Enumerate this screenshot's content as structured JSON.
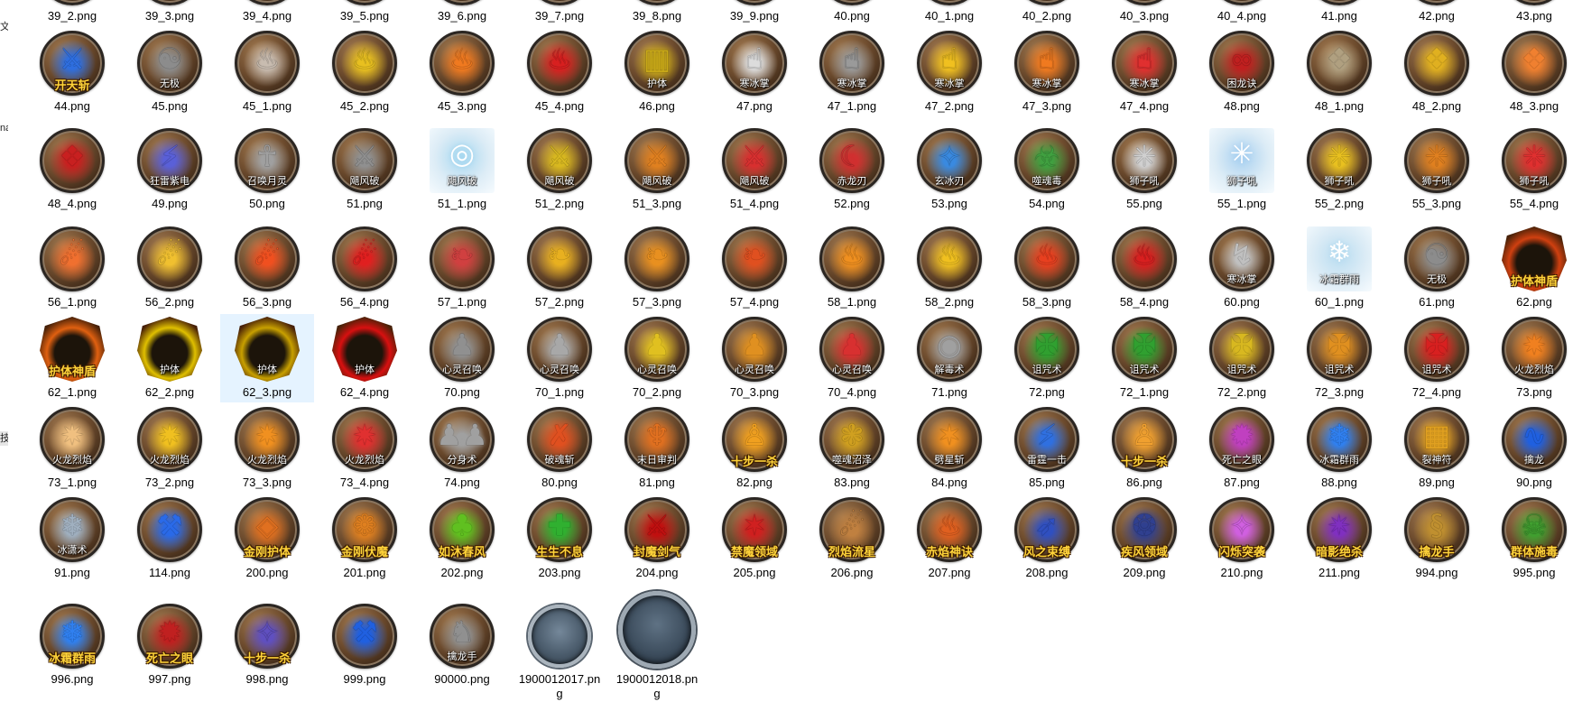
{
  "sidebar": {
    "fragments": [
      "文件",
      "na",
      "技"
    ]
  },
  "rows": [
    [
      {
        "file": "39_2.png",
        "icon": "skill-badge",
        "color": "#b86a2a"
      },
      {
        "file": "39_3.png",
        "icon": "skill-badge",
        "color": "#a0522d"
      },
      {
        "file": "39_4.png",
        "icon": "skill-badge",
        "color": "#c07a30"
      },
      {
        "file": "39_5.png",
        "icon": "skill-badge",
        "color": "#9a6a3a"
      },
      {
        "file": "39_6.png",
        "icon": "skill-badge",
        "color": "#c06030"
      },
      {
        "file": "39_7.png",
        "icon": "skill-badge",
        "color": "#b04a2a"
      },
      {
        "file": "39_8.png",
        "icon": "skill-badge",
        "color": "#c08a3a"
      },
      {
        "file": "39_9.png",
        "icon": "skill-badge",
        "color": "#a06040"
      },
      {
        "file": "40.png",
        "icon": "skill-badge",
        "color": "#8a6a4a"
      },
      {
        "file": "40_1.png",
        "icon": "skill-badge",
        "color": "#b07040"
      },
      {
        "file": "40_2.png",
        "icon": "skill-badge",
        "color": "#c09030"
      },
      {
        "file": "40_3.png",
        "icon": "skill-badge",
        "color": "#b06030"
      },
      {
        "file": "40_4.png",
        "icon": "skill-badge",
        "color": "#c04a2a"
      },
      {
        "file": "41.png",
        "icon": "skill-badge",
        "color": "#7a6a5a"
      },
      {
        "file": "42.png",
        "icon": "skill-badge",
        "color": "#c0a030"
      },
      {
        "file": "43.png",
        "icon": "skill-badge",
        "color": "#a06a40"
      }
    ],
    [
      {
        "file": "44.png",
        "icon": "blade-storm",
        "color": "#2f6fe0",
        "caption": "开天斩",
        "caption_style": "gold"
      },
      {
        "file": "45.png",
        "icon": "yin-yang",
        "color": "#8c8c8c",
        "caption": "无极"
      },
      {
        "file": "45_1.png",
        "icon": "flame-swirl",
        "color": "#c8bcb0"
      },
      {
        "file": "45_2.png",
        "icon": "flame-swirl",
        "color": "#e8c020"
      },
      {
        "file": "45_3.png",
        "icon": "flame-swirl",
        "color": "#f07a20"
      },
      {
        "file": "45_4.png",
        "icon": "flame-swirl",
        "color": "#d82020"
      },
      {
        "file": "46.png",
        "icon": "armor",
        "color": "#c8a818",
        "caption": "护体"
      },
      {
        "file": "47.png",
        "icon": "palm",
        "color": "#dcdcdc",
        "caption": "寒冰掌"
      },
      {
        "file": "47_1.png",
        "icon": "palm",
        "color": "#9a9a9a",
        "caption": "寒冰掌"
      },
      {
        "file": "47_2.png",
        "icon": "palm",
        "color": "#f0c020",
        "caption": "寒冰掌"
      },
      {
        "file": "47_3.png",
        "icon": "palm",
        "color": "#f07a20",
        "caption": "寒冰掌"
      },
      {
        "file": "47_4.png",
        "icon": "palm",
        "color": "#e03030",
        "caption": "寒冰掌"
      },
      {
        "file": "48.png",
        "icon": "dragon-knot",
        "color": "#c02020",
        "caption": "困龙诀"
      },
      {
        "file": "48_1.png",
        "icon": "totem",
        "color": "#b0a080"
      },
      {
        "file": "48_2.png",
        "icon": "totem",
        "color": "#e0b020"
      },
      {
        "file": "48_3.png",
        "icon": "totem",
        "color": "#f08030"
      }
    ],
    [
      {
        "file": "48_4.png",
        "icon": "totem",
        "color": "#c82020"
      },
      {
        "file": "49.png",
        "icon": "lightning",
        "color": "#5a60d8",
        "caption": "狂雷紫电"
      },
      {
        "file": "50.png",
        "icon": "summon",
        "color": "#a0a0a0",
        "caption": "召唤月灵"
      },
      {
        "file": "51.png",
        "icon": "sword",
        "color": "#909090",
        "caption": "飓风破"
      },
      {
        "file": "51_1.png",
        "icon": "whirlwind",
        "color": "#a8d8f0",
        "caption": "飓风破",
        "shape": "bare"
      },
      {
        "file": "51_2.png",
        "icon": "sword",
        "color": "#d8b820",
        "caption": "飓风破"
      },
      {
        "file": "51_3.png",
        "icon": "sword",
        "color": "#e08020",
        "caption": "飓风破"
      },
      {
        "file": "51_4.png",
        "icon": "sword",
        "color": "#d83030",
        "caption": "飓风破"
      },
      {
        "file": "52.png",
        "icon": "crescent-blade",
        "color": "#d03030",
        "caption": "赤龙刃"
      },
      {
        "file": "53.png",
        "icon": "ice-blade",
        "color": "#3a8ae0",
        "caption": "玄冰刃"
      },
      {
        "file": "54.png",
        "icon": "poison",
        "color": "#40a040",
        "caption": "噬魂毒"
      },
      {
        "file": "55.png",
        "icon": "roar",
        "color": "#d0d0d0",
        "caption": "狮子吼"
      },
      {
        "file": "55_1.png",
        "icon": "roar",
        "color": "#a8d0f0",
        "caption": "狮子吼",
        "shape": "bare"
      },
      {
        "file": "55_2.png",
        "icon": "roar",
        "color": "#e8c020",
        "caption": "狮子吼"
      },
      {
        "file": "55_3.png",
        "icon": "roar",
        "color": "#e08020",
        "caption": "狮子吼"
      },
      {
        "file": "55_4.png",
        "icon": "roar",
        "color": "#e03030",
        "caption": "狮子吼"
      }
    ],
    [
      {
        "file": "56_1.png",
        "icon": "fireball",
        "color": "#f07030"
      },
      {
        "file": "56_2.png",
        "icon": "fireball",
        "color": "#f0c030"
      },
      {
        "file": "56_3.png",
        "icon": "fireball",
        "color": "#f05020"
      },
      {
        "file": "56_4.png",
        "icon": "fireball",
        "color": "#e02020"
      },
      {
        "file": "57_1.png",
        "icon": "phoenix",
        "color": "#d04040"
      },
      {
        "file": "57_2.png",
        "icon": "phoenix",
        "color": "#e8b020"
      },
      {
        "file": "57_3.png",
        "icon": "phoenix",
        "color": "#e89020"
      },
      {
        "file": "57_4.png",
        "icon": "phoenix",
        "color": "#e05020"
      },
      {
        "file": "58_1.png",
        "icon": "flame-pillar",
        "color": "#f09020"
      },
      {
        "file": "58_2.png",
        "icon": "flame-pillar",
        "color": "#f0c020"
      },
      {
        "file": "58_3.png",
        "icon": "flame-pillar",
        "color": "#e84020"
      },
      {
        "file": "58_4.png",
        "icon": "flame-pillar",
        "color": "#d82020"
      },
      {
        "file": "60.png",
        "icon": "claw",
        "color": "#c0c0c0",
        "caption": "寒冰掌"
      },
      {
        "file": "60_1.png",
        "icon": "ice-shards",
        "color": "#b8dcf0",
        "caption": "冰霜群雨",
        "shape": "bare"
      },
      {
        "file": "61.png",
        "icon": "yin-yang",
        "color": "#8c8c8c",
        "caption": "无极"
      },
      {
        "file": "62.png",
        "icon": "shield",
        "color": "#d04010",
        "caption": "护体神盾",
        "caption_style": "gold",
        "shape": "shield"
      }
    ],
    [
      {
        "file": "62_1.png",
        "icon": "shield",
        "color": "#e06010",
        "caption": "护体神盾",
        "caption_style": "gold",
        "shape": "shield"
      },
      {
        "file": "62_2.png",
        "icon": "shield",
        "color": "#e0c000",
        "caption": "护体",
        "shape": "shield"
      },
      {
        "file": "62_3.png",
        "icon": "shield",
        "color": "#c8a000",
        "caption": "护体",
        "shape": "shield",
        "selected": true
      },
      {
        "file": "62_4.png",
        "icon": "shield",
        "color": "#d81010",
        "caption": "护体",
        "shape": "shield"
      },
      {
        "file": "70.png",
        "icon": "person",
        "color": "#909090",
        "caption": "心灵召唤"
      },
      {
        "file": "70_1.png",
        "icon": "person",
        "color": "#a8a8a8",
        "caption": "心灵召唤"
      },
      {
        "file": "70_2.png",
        "icon": "person",
        "color": "#e0c020",
        "caption": "心灵召唤"
      },
      {
        "file": "70_3.png",
        "icon": "person",
        "color": "#e09020",
        "caption": "心灵召唤"
      },
      {
        "file": "70_4.png",
        "icon": "person",
        "color": "#d83030",
        "caption": "心灵召唤"
      },
      {
        "file": "71.png",
        "icon": "eye",
        "color": "#a0a0a0",
        "caption": "解毒术"
      },
      {
        "file": "72.png",
        "icon": "curse-rune",
        "color": "#30a030",
        "caption": "诅咒术"
      },
      {
        "file": "72_1.png",
        "icon": "curse-rune",
        "color": "#30a030",
        "caption": "诅咒术"
      },
      {
        "file": "72_2.png",
        "icon": "curse-rune",
        "color": "#d8b820",
        "caption": "诅咒术"
      },
      {
        "file": "72_3.png",
        "icon": "curse-rune",
        "color": "#e09020",
        "caption": "诅咒术"
      },
      {
        "file": "72_4.png",
        "icon": "curse-rune",
        "color": "#d82020",
        "caption": "诅咒术"
      },
      {
        "file": "73.png",
        "icon": "fist-burst",
        "color": "#f08020",
        "caption": "火龙烈焰"
      }
    ],
    [
      {
        "file": "73_1.png",
        "icon": "fist-burst",
        "color": "#f0c080",
        "caption": "火龙烈焰"
      },
      {
        "file": "73_2.png",
        "icon": "fist-burst",
        "color": "#f0c020",
        "caption": "火龙烈焰"
      },
      {
        "file": "73_3.png",
        "icon": "fist-burst",
        "color": "#f09020",
        "caption": "火龙烈焰"
      },
      {
        "file": "73_4.png",
        "icon": "fist-burst",
        "color": "#e03030",
        "caption": "火龙烈焰"
      },
      {
        "file": "74.png",
        "icon": "twin-figures",
        "color": "#a0a0a0",
        "caption": "分身术"
      },
      {
        "file": "80.png",
        "icon": "slash",
        "color": "#e05020",
        "caption": "破魂斩"
      },
      {
        "file": "81.png",
        "icon": "dragon-head",
        "color": "#e07020",
        "caption": "末日审判"
      },
      {
        "file": "82.png",
        "icon": "warrior",
        "color": "#f0a020",
        "caption": "十步一杀",
        "caption_style": "gold"
      },
      {
        "file": "83.png",
        "icon": "swamp",
        "color": "#d0a020",
        "caption": "噬魂沼泽"
      },
      {
        "file": "84.png",
        "icon": "star-strike",
        "color": "#f09020",
        "caption": "劈星斩"
      },
      {
        "file": "85.png",
        "icon": "thunder-strike",
        "color": "#3070e0",
        "caption": "雷霆一击"
      },
      {
        "file": "86.png",
        "icon": "warrior",
        "color": "#f0a030",
        "caption": "十步一杀",
        "caption_style": "gold"
      },
      {
        "file": "87.png",
        "icon": "death-eye",
        "color": "#c040c0",
        "caption": "死亡之眼"
      },
      {
        "file": "88.png",
        "icon": "ice-rain",
        "color": "#3080f0",
        "caption": "冰霜群雨"
      },
      {
        "file": "89.png",
        "icon": "talisman",
        "color": "#e0a020",
        "caption": "裂神符"
      },
      {
        "file": "90.png",
        "icon": "sea-dragon",
        "color": "#2060e0",
        "caption": "擒龙"
      }
    ],
    [
      {
        "file": "91.png",
        "icon": "ice-shards",
        "color": "#a0b0c0",
        "caption": "冰潇术"
      },
      {
        "file": "114.png",
        "icon": "hammer",
        "color": "#2a6ae8"
      },
      {
        "file": "200.png",
        "icon": "guard",
        "color": "#e07020",
        "caption": "金刚护体",
        "caption_style": "gold"
      },
      {
        "file": "201.png",
        "icon": "lotus",
        "color": "#e08020",
        "caption": "金刚伏魔",
        "caption_style": "gold"
      },
      {
        "file": "202.png",
        "icon": "breeze",
        "color": "#60c020",
        "caption": "如沐春风",
        "caption_style": "gold"
      },
      {
        "file": "203.png",
        "icon": "heal-cross",
        "color": "#30b030",
        "caption": "生生不息",
        "caption_style": "gold"
      },
      {
        "file": "204.png",
        "icon": "dark-sword",
        "color": "#c01010",
        "caption": "封魔剑气",
        "caption_style": "gold"
      },
      {
        "file": "205.png",
        "icon": "seal-field",
        "color": "#d02020",
        "caption": "禁魔领域",
        "caption_style": "gold"
      },
      {
        "file": "206.png",
        "icon": "meteor",
        "color": "#c08040",
        "caption": "烈焰流星",
        "caption_style": "gold"
      },
      {
        "file": "207.png",
        "icon": "fire-fist",
        "color": "#e06020",
        "caption": "赤焰神诀",
        "caption_style": "gold"
      },
      {
        "file": "208.png",
        "icon": "wind-bind",
        "color": "#3050c0",
        "caption": "风之束缚",
        "caption_style": "gold"
      },
      {
        "file": "209.png",
        "icon": "gale",
        "color": "#304090",
        "caption": "疾风领域",
        "caption_style": "gold"
      },
      {
        "file": "210.png",
        "icon": "flash",
        "color": "#d060e0",
        "caption": "闪烁突袭",
        "caption_style": "gold"
      },
      {
        "file": "211.png",
        "icon": "shadow-kill",
        "color": "#8030c0",
        "caption": "暗影绝杀",
        "caption_style": "gold"
      },
      {
        "file": "994.png",
        "icon": "serpent",
        "color": "#c09030",
        "caption": "擒龙手",
        "caption_style": "gold"
      },
      {
        "file": "995.png",
        "icon": "skull",
        "color": "#40a030",
        "caption": "群体施毒",
        "caption_style": "gold"
      }
    ],
    [
      {
        "file": "996.png",
        "icon": "ice-rain",
        "color": "#3080f0",
        "caption": "冰霜群雨",
        "caption_style": "gold"
      },
      {
        "file": "997.png",
        "icon": "death-eye",
        "color": "#c02020",
        "caption": "死亡之眼",
        "caption_style": "gold"
      },
      {
        "file": "998.png",
        "icon": "flash",
        "color": "#6050c0",
        "caption": "十步一杀",
        "caption_style": "gold"
      },
      {
        "file": "999.png",
        "icon": "hammer",
        "color": "#2060e0"
      },
      {
        "file": "90000.png",
        "icon": "horse-rider",
        "color": "#909090",
        "caption": "擒龙手"
      },
      {
        "file": "1900012017.png",
        "icon": "ring",
        "color": "#6a7a8a",
        "shape": "ring"
      },
      {
        "file": "1900012018.png",
        "icon": "ring",
        "color": "#4a5a6a",
        "shape": "ring-large"
      }
    ]
  ]
}
